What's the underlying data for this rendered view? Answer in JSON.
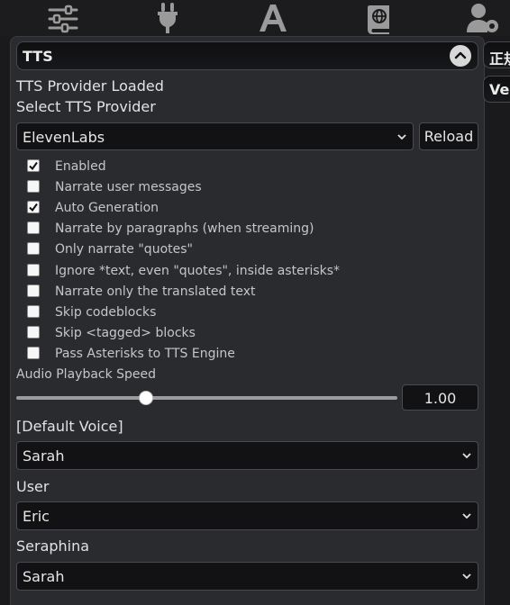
{
  "topbar": {
    "icons": [
      "sliders-icon",
      "plug-icon",
      "font-icon",
      "book-icon",
      "user-gear-icon"
    ]
  },
  "panel": {
    "title": "TTS",
    "peek_tabs": [
      "正規",
      "Vec"
    ]
  },
  "status": {
    "provider_loaded": "TTS Provider Loaded",
    "select_provider": "Select TTS Provider"
  },
  "provider": {
    "selected": "ElevenLabs",
    "reload_label": "Reload"
  },
  "options": [
    {
      "label": "Enabled",
      "checked": true
    },
    {
      "label": "Narrate user messages",
      "checked": false
    },
    {
      "label": "Auto Generation",
      "checked": true
    },
    {
      "label": "Narrate by paragraphs (when streaming)",
      "checked": false
    },
    {
      "label": "Only narrate \"quotes\"",
      "checked": false
    },
    {
      "label": "Ignore *text, even \"quotes\", inside asterisks*",
      "checked": false
    },
    {
      "label": "Narrate only the translated text",
      "checked": false
    },
    {
      "label": "Skip codeblocks",
      "checked": false
    },
    {
      "label": "Skip <tagged> blocks",
      "checked": false
    },
    {
      "label": "Pass Asterisks to TTS Engine",
      "checked": false
    }
  ],
  "playback": {
    "label": "Audio Playback Speed",
    "value": "1.00",
    "slider_fraction": 0.34
  },
  "voices": [
    {
      "name": "[Default Voice]",
      "selected": "Sarah"
    },
    {
      "name": "User",
      "selected": "Eric"
    },
    {
      "name": "Seraphina",
      "selected": "Sarah"
    }
  ]
}
